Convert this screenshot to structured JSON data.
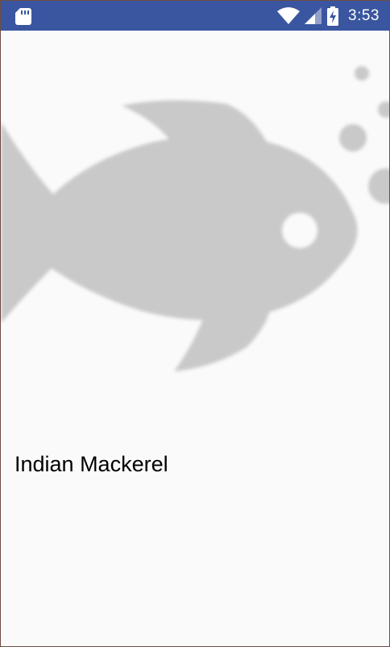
{
  "status_bar": {
    "time": "3:53",
    "background_color": "#3a56a0",
    "icons": [
      "sd-card-icon",
      "wifi-icon",
      "cell-signal-icon",
      "battery-charging-icon"
    ]
  },
  "hero_image": {
    "icon": "fish-icon",
    "color": "#c9c9c9"
  },
  "fish": {
    "name": "Indian Mackerel"
  }
}
